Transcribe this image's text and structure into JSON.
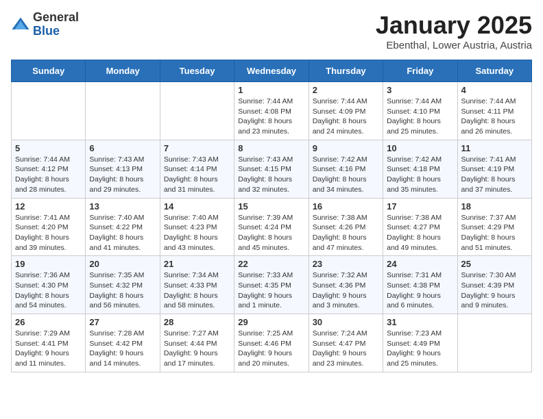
{
  "header": {
    "logo_general": "General",
    "logo_blue": "Blue",
    "month_title": "January 2025",
    "location": "Ebenthal, Lower Austria, Austria"
  },
  "days_of_week": [
    "Sunday",
    "Monday",
    "Tuesday",
    "Wednesday",
    "Thursday",
    "Friday",
    "Saturday"
  ],
  "weeks": [
    [
      {
        "day": "",
        "info": ""
      },
      {
        "day": "",
        "info": ""
      },
      {
        "day": "",
        "info": ""
      },
      {
        "day": "1",
        "info": "Sunrise: 7:44 AM\nSunset: 4:08 PM\nDaylight: 8 hours and 23 minutes."
      },
      {
        "day": "2",
        "info": "Sunrise: 7:44 AM\nSunset: 4:09 PM\nDaylight: 8 hours and 24 minutes."
      },
      {
        "day": "3",
        "info": "Sunrise: 7:44 AM\nSunset: 4:10 PM\nDaylight: 8 hours and 25 minutes."
      },
      {
        "day": "4",
        "info": "Sunrise: 7:44 AM\nSunset: 4:11 PM\nDaylight: 8 hours and 26 minutes."
      }
    ],
    [
      {
        "day": "5",
        "info": "Sunrise: 7:44 AM\nSunset: 4:12 PM\nDaylight: 8 hours and 28 minutes."
      },
      {
        "day": "6",
        "info": "Sunrise: 7:43 AM\nSunset: 4:13 PM\nDaylight: 8 hours and 29 minutes."
      },
      {
        "day": "7",
        "info": "Sunrise: 7:43 AM\nSunset: 4:14 PM\nDaylight: 8 hours and 31 minutes."
      },
      {
        "day": "8",
        "info": "Sunrise: 7:43 AM\nSunset: 4:15 PM\nDaylight: 8 hours and 32 minutes."
      },
      {
        "day": "9",
        "info": "Sunrise: 7:42 AM\nSunset: 4:16 PM\nDaylight: 8 hours and 34 minutes."
      },
      {
        "day": "10",
        "info": "Sunrise: 7:42 AM\nSunset: 4:18 PM\nDaylight: 8 hours and 35 minutes."
      },
      {
        "day": "11",
        "info": "Sunrise: 7:41 AM\nSunset: 4:19 PM\nDaylight: 8 hours and 37 minutes."
      }
    ],
    [
      {
        "day": "12",
        "info": "Sunrise: 7:41 AM\nSunset: 4:20 PM\nDaylight: 8 hours and 39 minutes."
      },
      {
        "day": "13",
        "info": "Sunrise: 7:40 AM\nSunset: 4:22 PM\nDaylight: 8 hours and 41 minutes."
      },
      {
        "day": "14",
        "info": "Sunrise: 7:40 AM\nSunset: 4:23 PM\nDaylight: 8 hours and 43 minutes."
      },
      {
        "day": "15",
        "info": "Sunrise: 7:39 AM\nSunset: 4:24 PM\nDaylight: 8 hours and 45 minutes."
      },
      {
        "day": "16",
        "info": "Sunrise: 7:38 AM\nSunset: 4:26 PM\nDaylight: 8 hours and 47 minutes."
      },
      {
        "day": "17",
        "info": "Sunrise: 7:38 AM\nSunset: 4:27 PM\nDaylight: 8 hours and 49 minutes."
      },
      {
        "day": "18",
        "info": "Sunrise: 7:37 AM\nSunset: 4:29 PM\nDaylight: 8 hours and 51 minutes."
      }
    ],
    [
      {
        "day": "19",
        "info": "Sunrise: 7:36 AM\nSunset: 4:30 PM\nDaylight: 8 hours and 54 minutes."
      },
      {
        "day": "20",
        "info": "Sunrise: 7:35 AM\nSunset: 4:32 PM\nDaylight: 8 hours and 56 minutes."
      },
      {
        "day": "21",
        "info": "Sunrise: 7:34 AM\nSunset: 4:33 PM\nDaylight: 8 hours and 58 minutes."
      },
      {
        "day": "22",
        "info": "Sunrise: 7:33 AM\nSunset: 4:35 PM\nDaylight: 9 hours and 1 minute."
      },
      {
        "day": "23",
        "info": "Sunrise: 7:32 AM\nSunset: 4:36 PM\nDaylight: 9 hours and 3 minutes."
      },
      {
        "day": "24",
        "info": "Sunrise: 7:31 AM\nSunset: 4:38 PM\nDaylight: 9 hours and 6 minutes."
      },
      {
        "day": "25",
        "info": "Sunrise: 7:30 AM\nSunset: 4:39 PM\nDaylight: 9 hours and 9 minutes."
      }
    ],
    [
      {
        "day": "26",
        "info": "Sunrise: 7:29 AM\nSunset: 4:41 PM\nDaylight: 9 hours and 11 minutes."
      },
      {
        "day": "27",
        "info": "Sunrise: 7:28 AM\nSunset: 4:42 PM\nDaylight: 9 hours and 14 minutes."
      },
      {
        "day": "28",
        "info": "Sunrise: 7:27 AM\nSunset: 4:44 PM\nDaylight: 9 hours and 17 minutes."
      },
      {
        "day": "29",
        "info": "Sunrise: 7:25 AM\nSunset: 4:46 PM\nDaylight: 9 hours and 20 minutes."
      },
      {
        "day": "30",
        "info": "Sunrise: 7:24 AM\nSunset: 4:47 PM\nDaylight: 9 hours and 23 minutes."
      },
      {
        "day": "31",
        "info": "Sunrise: 7:23 AM\nSunset: 4:49 PM\nDaylight: 9 hours and 25 minutes."
      },
      {
        "day": "",
        "info": ""
      }
    ]
  ]
}
